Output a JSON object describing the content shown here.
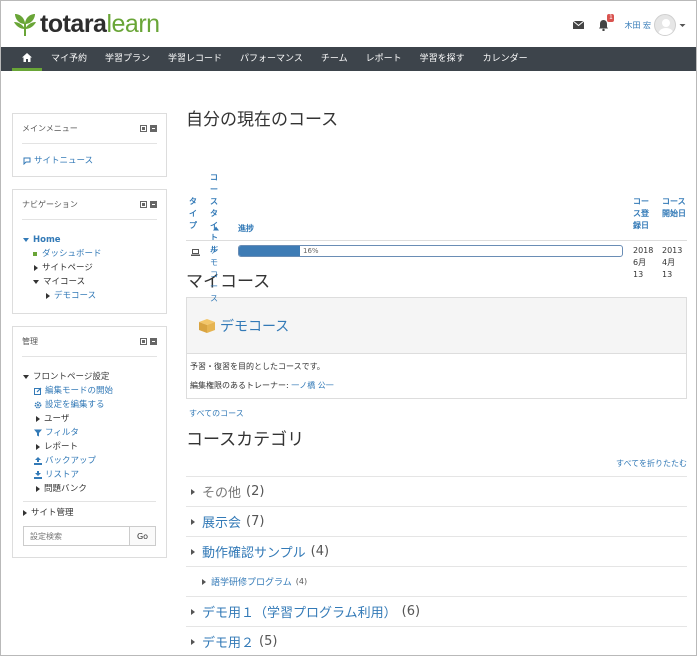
{
  "header": {
    "logo_bold": "totara",
    "logo_light": "learn",
    "notification_count": "1",
    "user_name": "木田 宏"
  },
  "nav": {
    "items": [
      "マイ予約",
      "学習プラン",
      "学習レコード",
      "パフォーマンス",
      "チーム",
      "レポート",
      "学習を探す",
      "カレンダー"
    ]
  },
  "sidebar": {
    "main_menu": {
      "title": "メインメニュー",
      "site_news": "サイトニュース"
    },
    "navigation": {
      "title": "ナビゲーション",
      "home": "Home",
      "dashboard": "ダッシュボード",
      "site_pages": "サイトページ",
      "my_courses": "マイコース",
      "demo_course": "デモコース"
    },
    "admin": {
      "title": "管理",
      "front_page_settings": "フロントページ設定",
      "turn_editing_on": "編集モードの開始",
      "edit_settings": "設定を編集する",
      "users": "ユーザ",
      "filters": "フィルタ",
      "reports": "レポート",
      "backup": "バックアップ",
      "restore": "リストア",
      "question_bank": "問題バンク",
      "site_admin": "サイト管理",
      "search_placeholder": "設定検索",
      "search_button": "Go"
    }
  },
  "current_courses": {
    "title": "自分の現在のコース",
    "col_type": "タイプ",
    "col_title": "コースタイトル",
    "col_progress": "進捗",
    "col_enrolled": "コース登録日",
    "col_started": "コース開始日",
    "row": {
      "title": "デモコース",
      "progress_percent": 16,
      "progress_label": "16%",
      "enrolled_date": "2018 6月 13",
      "started_date": "2013 4月 13"
    }
  },
  "my_courses": {
    "title": "マイコース",
    "course_name": "デモコース",
    "summary": "予習・復習を目的としたコースです。",
    "teacher_label": "編集権限のあるトレーナー: ",
    "teacher_name": "一ノ橋 公一",
    "all_courses": "すべてのコース"
  },
  "categories": {
    "title": "コースカテゴリ",
    "collapse_all": "すべてを折りたたむ",
    "items": [
      {
        "name": "その他",
        "count": "(2)"
      },
      {
        "name": "展示会",
        "count": "(7)"
      },
      {
        "name": "動作確認サンプル",
        "count": "(4)"
      },
      {
        "name": "語学研修プログラム",
        "count": "(4)"
      },
      {
        "name": "デモ用１（学習プログラム利用）",
        "count": "(6)"
      },
      {
        "name": "デモ用２",
        "count": "(5)"
      }
    ]
  }
}
